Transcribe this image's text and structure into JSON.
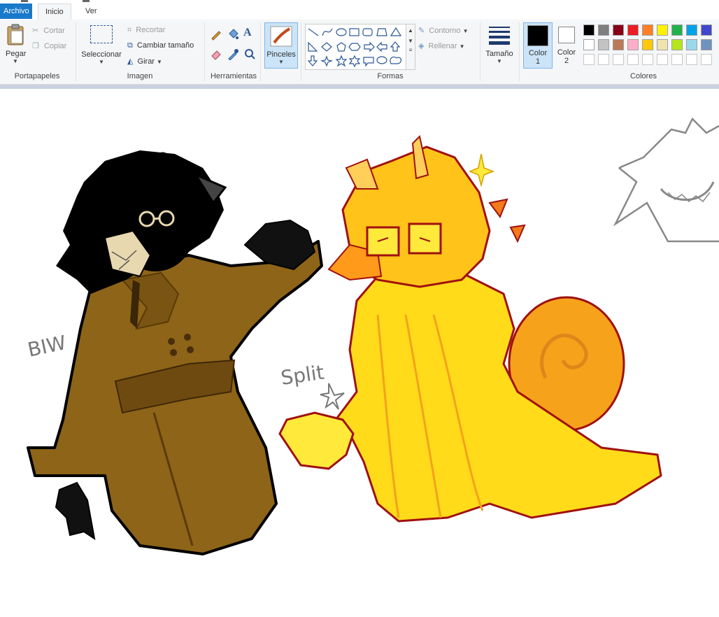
{
  "tabs": {
    "file": "Archivo",
    "home": "Inicio",
    "view": "Ver"
  },
  "clipboard": {
    "paste": "Pegar",
    "cut": "Cortar",
    "copy": "Copiar",
    "label": "Portapapeles"
  },
  "image": {
    "select": "Seleccionar",
    "crop": "Recortar",
    "resize": "Cambiar tamaño",
    "rotate": "Girar",
    "label": "Imagen"
  },
  "tools": {
    "label": "Herramientas"
  },
  "brushes": {
    "label": "Pinceles"
  },
  "shapes": {
    "outline": "Contorno",
    "fill": "Rellenar",
    "label": "Formas"
  },
  "size": {
    "label": "Tamaño"
  },
  "colors": {
    "color1": "Color",
    "color1_num": "1",
    "color2": "Color",
    "color2_num": "2",
    "label": "Colores",
    "palette_row1": [
      "#000000",
      "#7f7f7f",
      "#880015",
      "#ed1c24",
      "#ff7f27",
      "#fff200",
      "#22b14c",
      "#00a2e8",
      "#3f48cc"
    ],
    "palette_row2": [
      "#ffffff",
      "#c3c3c3",
      "#b97a57",
      "#ffaec9",
      "#ffc90e",
      "#efe4b0",
      "#b5e61d",
      "#99d9ea",
      "#7092be"
    ]
  },
  "canvas": {
    "label_left": "BIW",
    "label_right": "Split"
  }
}
